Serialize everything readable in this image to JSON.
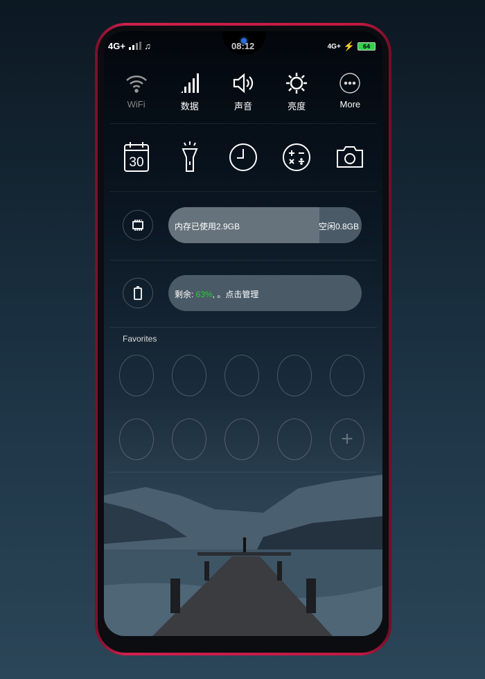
{
  "status_bar": {
    "left": "4G+",
    "time": "08:12",
    "right_network": "4G+",
    "battery_level": "64",
    "battery_color": "#2fd34a"
  },
  "toggles": [
    {
      "icon": "wifi-icon",
      "label": "WiFi",
      "active": false
    },
    {
      "icon": "signal-icon",
      "label": "数据",
      "active": true
    },
    {
      "icon": "speaker-icon",
      "label": "声音",
      "active": true
    },
    {
      "icon": "brightness-icon",
      "label": "亮度",
      "active": true
    },
    {
      "icon": "more-icon",
      "label": "More",
      "active": true
    }
  ],
  "shortcuts": [
    {
      "icon": "calendar-icon",
      "text": "30"
    },
    {
      "icon": "flashlight-icon"
    },
    {
      "icon": "clock-icon"
    },
    {
      "icon": "calculator-icon"
    },
    {
      "icon": "camera-icon"
    }
  ],
  "memory": {
    "used_label": "内存已使用2.9GB",
    "free_label": "空闲0.8GB",
    "used_fraction": 0.78
  },
  "battery": {
    "prefix": "剩余: ",
    "percent": "63%",
    "suffix": ", 。点击管理",
    "accent": "#22d12f"
  },
  "favorites": {
    "title": "Favorites",
    "add_icon": "plus-icon"
  }
}
